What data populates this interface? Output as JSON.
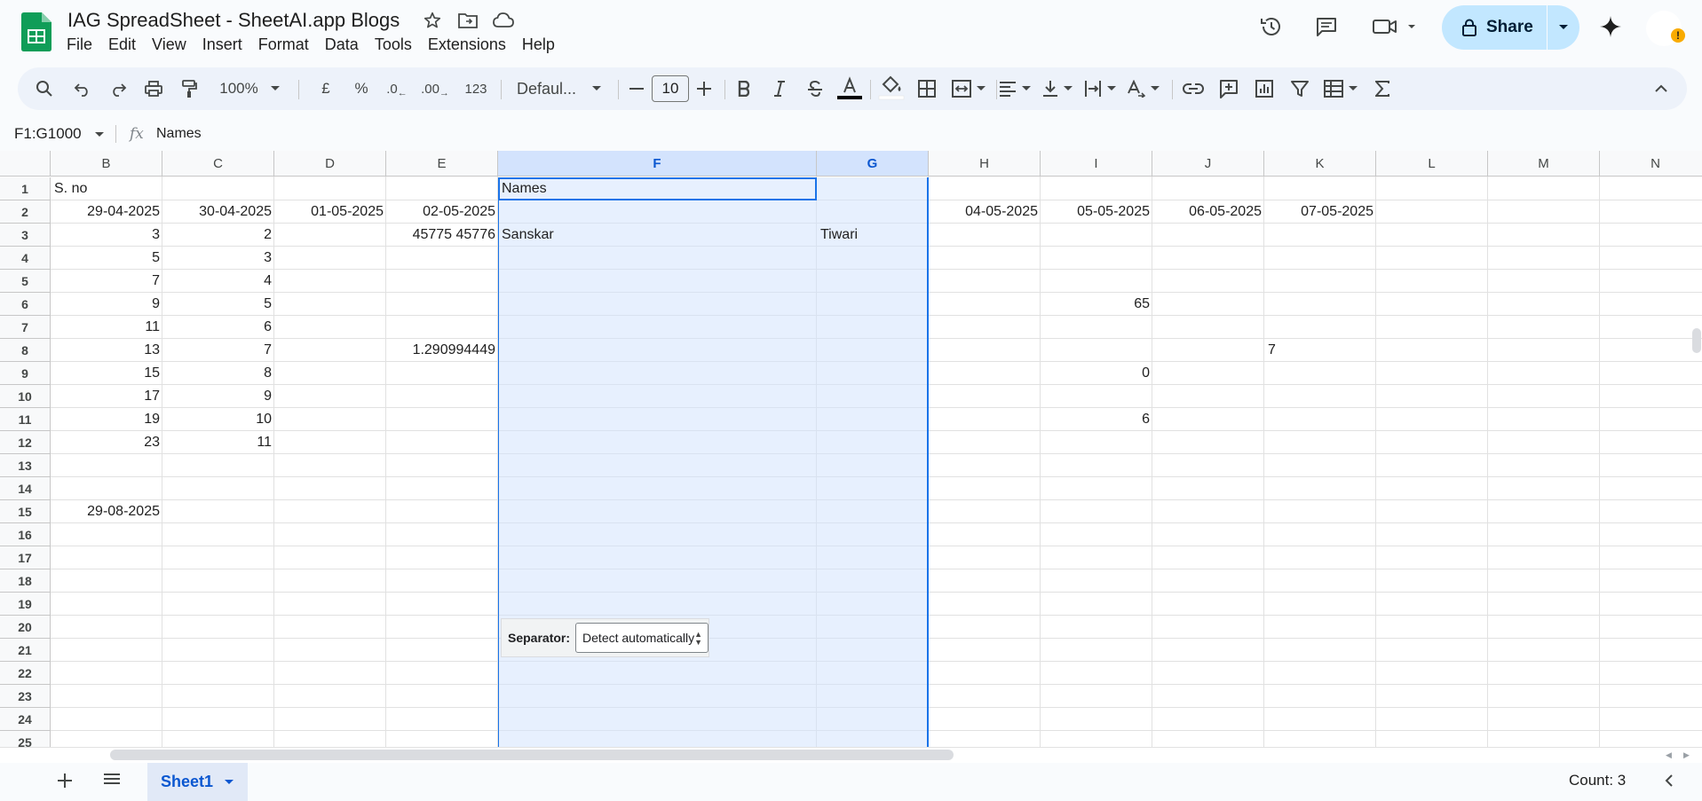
{
  "doc": {
    "title": "IAG SpreadSheet - SheetAI.app Blogs"
  },
  "menu": [
    "File",
    "Edit",
    "View",
    "Insert",
    "Format",
    "Data",
    "Tools",
    "Extensions",
    "Help"
  ],
  "share": {
    "label": "Share"
  },
  "toolbar": {
    "zoom": "100%",
    "currency": "£",
    "percent": "%",
    "decrease_decimal": ".0",
    "increase_decimal": ".00",
    "number_format": "123",
    "font": "Defaul...",
    "font_size": "10"
  },
  "formula_bar": {
    "name_box": "F1:G1000",
    "fx": "fx",
    "value": "Names"
  },
  "columns": [
    "B",
    "C",
    "D",
    "E",
    "F",
    "G",
    "H",
    "I",
    "J",
    "K",
    "L",
    "M",
    "N"
  ],
  "rows": [
    "1",
    "2",
    "3",
    "4",
    "5",
    "6",
    "7",
    "8",
    "9",
    "10",
    "11",
    "12",
    "13",
    "14",
    "15",
    "16",
    "17",
    "18",
    "19",
    "20",
    "21",
    "22",
    "23",
    "24",
    "25"
  ],
  "cells": {
    "B1": "S. no",
    "B2": "29-04-2025",
    "C2": "30-04-2025",
    "D2": "01-05-2025",
    "E2": "02-05-2025",
    "H2": "04-05-2025",
    "I2": "05-05-2025",
    "J2": "06-05-2025",
    "K2": "07-05-2025",
    "F1": "Names",
    "B3": "3",
    "C3": "2",
    "E3": "45775 45776",
    "F3": "Sanskar",
    "G3": "Tiwari",
    "B4": "5",
    "C4": "3",
    "B5": "7",
    "C5": "4",
    "B6": "9",
    "C6": "5",
    "I6": "65",
    "B7": "11",
    "C7": "6",
    "B8": "13",
    "C8": "7",
    "E8": "1.290994449",
    "K8": "7",
    "B9": "15",
    "C9": "8",
    "I9": "0",
    "B10": "17",
    "C10": "9",
    "B11": "19",
    "C11": "10",
    "I11": "6",
    "B12": "23",
    "C12": "11",
    "B15": "29-08-2025"
  },
  "separator_widget": {
    "label": "Separator:",
    "value": "Detect automatically"
  },
  "sheets": [
    {
      "name": "Sheet1"
    }
  ],
  "status": {
    "count": "Count: 3"
  },
  "colors": {
    "accent": "#0b57d0",
    "selection": "#d3e3fd",
    "share_bg": "#c2e7ff",
    "sheets_green": "#0f9d58"
  }
}
